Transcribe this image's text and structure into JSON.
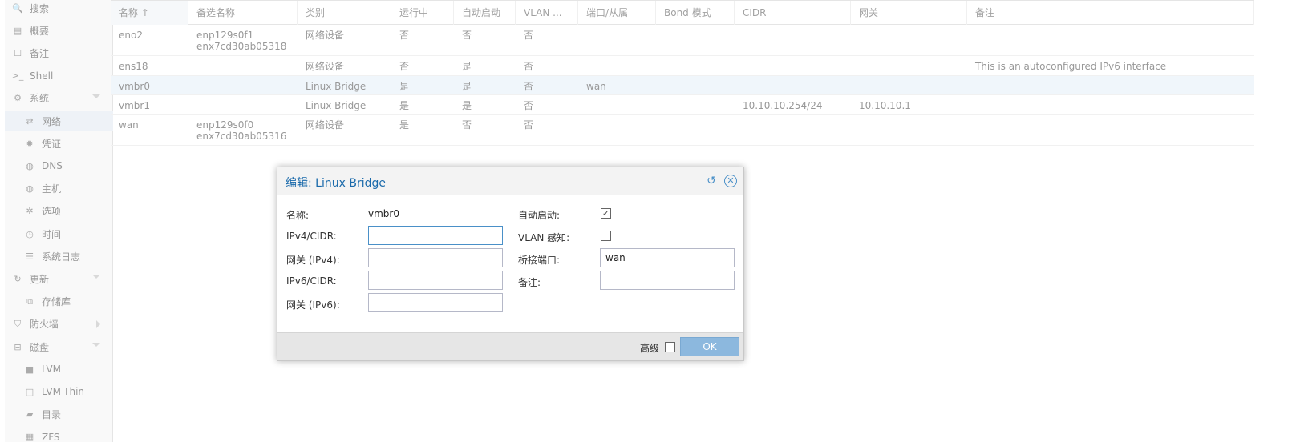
{
  "sidebar": {
    "items": [
      {
        "label": "搜索",
        "icon": "search-icon",
        "glyph": "🔍",
        "level": "top",
        "arrow": ""
      },
      {
        "label": "概要",
        "icon": "book-icon",
        "glyph": "▤",
        "level": "top",
        "arrow": ""
      },
      {
        "label": "备注",
        "icon": "note-icon",
        "glyph": "☐",
        "level": "top",
        "arrow": ""
      },
      {
        "label": "Shell",
        "icon": "terminal-icon",
        "glyph": ">_",
        "level": "top",
        "arrow": ""
      },
      {
        "label": "系统",
        "icon": "cogs-icon",
        "glyph": "⚙",
        "level": "top",
        "arrow": "down"
      },
      {
        "label": "网络",
        "icon": "exchange-icon",
        "glyph": "⇄",
        "level": "sub",
        "arrow": "",
        "selected": true
      },
      {
        "label": "凭证",
        "icon": "certificate-icon",
        "glyph": "✹",
        "level": "sub",
        "arrow": ""
      },
      {
        "label": "DNS",
        "icon": "globe-icon",
        "glyph": "◍",
        "level": "sub",
        "arrow": ""
      },
      {
        "label": "主机",
        "icon": "globe-icon",
        "glyph": "◍",
        "level": "sub",
        "arrow": ""
      },
      {
        "label": "选项",
        "icon": "gear-icon",
        "glyph": "✲",
        "level": "sub",
        "arrow": ""
      },
      {
        "label": "时间",
        "icon": "clock-icon",
        "glyph": "◷",
        "level": "sub",
        "arrow": ""
      },
      {
        "label": "系统日志",
        "icon": "list-icon",
        "glyph": "☰",
        "level": "sub",
        "arrow": ""
      },
      {
        "label": "更新",
        "icon": "refresh-icon",
        "glyph": "↻",
        "level": "top",
        "arrow": "down"
      },
      {
        "label": "存储库",
        "icon": "copy-icon",
        "glyph": "⧉",
        "level": "sub",
        "arrow": ""
      },
      {
        "label": "防火墙",
        "icon": "shield-icon",
        "glyph": "⛉",
        "level": "top",
        "arrow": "right"
      },
      {
        "label": "磁盘",
        "icon": "hdd-icon",
        "glyph": "⊟",
        "level": "top",
        "arrow": "down"
      },
      {
        "label": "LVM",
        "icon": "square-icon",
        "glyph": "■",
        "level": "sub",
        "arrow": ""
      },
      {
        "label": "LVM-Thin",
        "icon": "square-outline-icon",
        "glyph": "□",
        "level": "sub",
        "arrow": ""
      },
      {
        "label": "目录",
        "icon": "folder-icon",
        "glyph": "▰",
        "level": "sub",
        "arrow": ""
      },
      {
        "label": "ZFS",
        "icon": "th-icon",
        "glyph": "▦",
        "level": "sub",
        "arrow": ""
      }
    ]
  },
  "grid": {
    "columns": [
      "名称 ↑",
      "备选名称",
      "类别",
      "运行中",
      "自动启动",
      "VLAN ...",
      "端口/从属",
      "Bond 模式",
      "CIDR",
      "网关",
      "备注"
    ],
    "rows": [
      {
        "name": "eno2",
        "alt1": "enp129s0f1",
        "alt2": "enx7cd30ab05318",
        "type": "网络设备",
        "active": "否",
        "autostart": "否",
        "vlan": "否",
        "ports": "",
        "bond": "",
        "cidr": "",
        "gateway": "",
        "comment": ""
      },
      {
        "name": "ens18",
        "alt1": "",
        "alt2": "",
        "type": "网络设备",
        "active": "否",
        "autostart": "是",
        "vlan": "否",
        "ports": "",
        "bond": "",
        "cidr": "",
        "gateway": "",
        "comment": "This is an autoconfigured IPv6 interface"
      },
      {
        "name": "vmbr0",
        "alt1": "",
        "alt2": "",
        "type": "Linux Bridge",
        "active": "是",
        "autostart": "是",
        "vlan": "否",
        "ports": "wan",
        "bond": "",
        "cidr": "",
        "gateway": "",
        "comment": ""
      },
      {
        "name": "vmbr1",
        "alt1": "",
        "alt2": "",
        "type": "Linux Bridge",
        "active": "是",
        "autostart": "是",
        "vlan": "否",
        "ports": "",
        "bond": "",
        "cidr": "10.10.10.254/24",
        "gateway": "10.10.10.1",
        "comment": ""
      },
      {
        "name": "wan",
        "alt1": "enp129s0f0",
        "alt2": "enx7cd30ab05316",
        "type": "网络设备",
        "active": "是",
        "autostart": "否",
        "vlan": "否",
        "ports": "",
        "bond": "",
        "cidr": "",
        "gateway": "",
        "comment": ""
      }
    ]
  },
  "dialog": {
    "title": "编辑: Linux Bridge",
    "name_label": "名称:",
    "name_value": "vmbr0",
    "ipv4_label": "IPv4/CIDR:",
    "ipv4_value": "",
    "gw4_label": "网关 (IPv4):",
    "gw4_value": "",
    "ipv6_label": "IPv6/CIDR:",
    "ipv6_value": "",
    "gw6_label": "网关 (IPv6):",
    "gw6_value": "",
    "autostart_label": "自动启动:",
    "autostart_checked": "✓",
    "vlan_label": "VLAN 感知:",
    "vlan_checked": "",
    "ports_label": "桥接端口:",
    "ports_value": "wan",
    "comment_label": "备注:",
    "comment_value": "",
    "advanced_label": "高级",
    "ok_label": "OK",
    "reset_icon": "↺",
    "close_icon": "✕"
  },
  "colors": {
    "accent": "#1a6aab",
    "ok_button": "#8cb8de",
    "selected_row": "#e4eef8"
  }
}
